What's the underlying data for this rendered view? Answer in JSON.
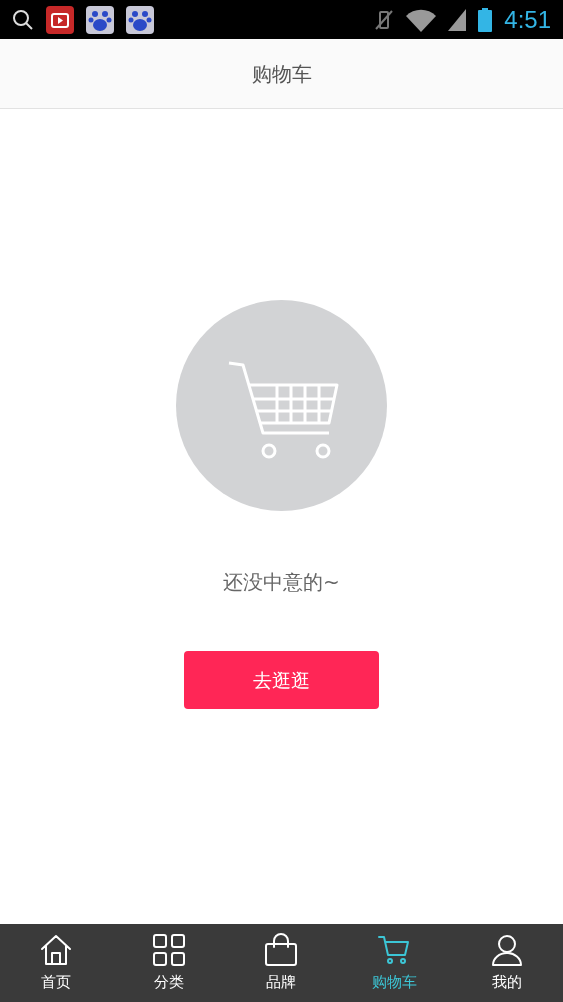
{
  "status_bar": {
    "time": "4:51"
  },
  "header": {
    "title": "购物车"
  },
  "empty_state": {
    "message": "还没中意的~",
    "button": "去逛逛"
  },
  "tabs": [
    {
      "label": "首页",
      "kind": "home",
      "selected": false
    },
    {
      "label": "分类",
      "kind": "grid",
      "selected": false
    },
    {
      "label": "品牌",
      "kind": "bag",
      "selected": false
    },
    {
      "label": "购物车",
      "kind": "cart",
      "selected": true
    },
    {
      "label": "我的",
      "kind": "user",
      "selected": false
    }
  ]
}
